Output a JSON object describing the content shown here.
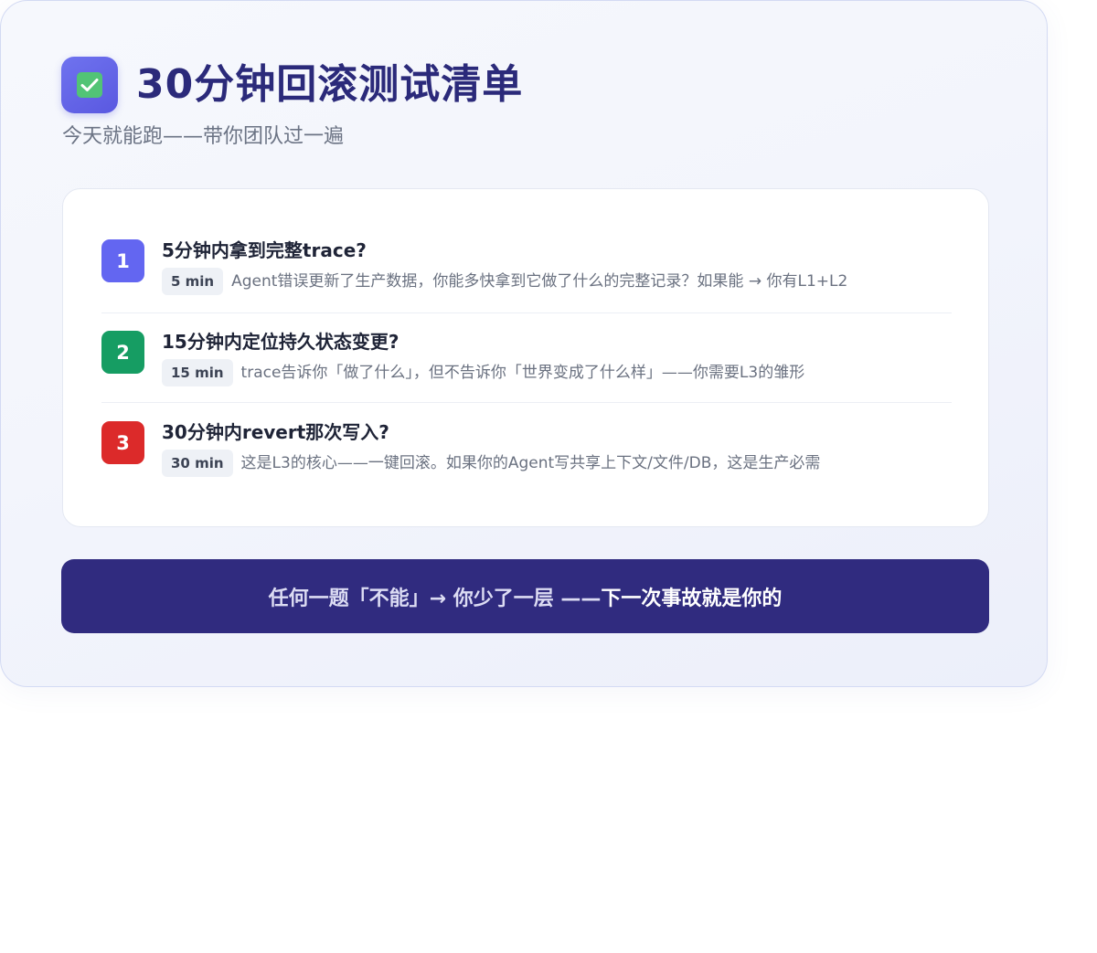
{
  "header": {
    "icon": "check-box-icon",
    "title": "30分钟回滚测试清单",
    "subtitle": "今天就能跑——带你团队过一遍"
  },
  "checklist": {
    "items": [
      {
        "number": "1",
        "color": "#6366f1",
        "title": "5分钟内拿到完整trace?",
        "time": "5 min",
        "description": "Agent错误更新了生产数据，你能多快拿到它做了什么的完整记录？如果能 → 你有L1+L2"
      },
      {
        "number": "2",
        "color": "#169d63",
        "title": "15分钟内定位持久状态变更?",
        "time": "15 min",
        "description": "trace告诉你「做了什么」，但不告诉你「世界变成了什么样」——你需要L3的雏形"
      },
      {
        "number": "3",
        "color": "#dc2a2a",
        "title": "30分钟内revert那次写入?",
        "time": "30 min",
        "description": "这是L3的核心——一键回滚。如果你的Agent写共享上下文/文件/DB，这是生产必需"
      }
    ]
  },
  "banner": {
    "part1": "任何一题「不能」→ 你少了一层 —— ",
    "part2": "下一次事故就是你的"
  }
}
